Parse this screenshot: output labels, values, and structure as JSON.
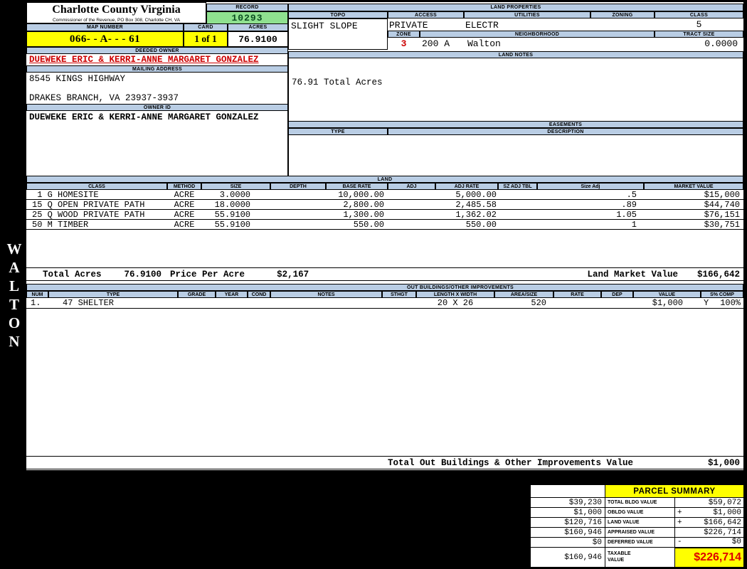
{
  "colors": {
    "header_blue": "#b9cde4",
    "highlight_yellow": "#ffff00",
    "record_green": "#8fe18f",
    "alert_red": "#cc0000"
  },
  "sidebar": {
    "watermark": "WALTON"
  },
  "header": {
    "county": "Charlotte County Virginia",
    "commissioner": "Commissioner of the Revenue, PO Box 308, Charlotte CH, VA",
    "record_label": "RECORD",
    "record_value": "10293",
    "map_number_label": "MAP NUMBER",
    "map_number": "066- - A- - - 61",
    "card_label": "CARD",
    "card_value": "1 of 1",
    "acres_label": "ACRES",
    "acres_value": "76.9100"
  },
  "land_properties": {
    "title": "LAND PROPERTIES",
    "topo_label": "TOPO",
    "topo": "SLIGHT SLOPE",
    "access_label": "ACCESS",
    "access": "PRIVATE",
    "utilities_label": "UTILITIES",
    "utilities": "ELECTR",
    "zoning_label": "ZONING",
    "class_label": "CLASS",
    "class": "5",
    "zone_label": "ZONE",
    "zone": "3",
    "zone_area": "200 A",
    "neighborhood_label": "NEIGHBORHOOD",
    "neighborhood": "Walton",
    "tract_size_label": "TRACT SIZE",
    "tract_size": "0.0000"
  },
  "owner": {
    "deeded_owner_label": "DEEDED OWNER",
    "deeded_owner": "DUEWEKE ERIC & KERRI-ANNE MARGARET GONZALEZ",
    "mailing_address_label": "MAILING ADDRESS",
    "address_line1": "8545 KINGS HIGHWAY",
    "address_line2": "DRAKES BRANCH, VA 23937-3937",
    "owner_id_label": "OWNER ID",
    "owner_id": "DUEWEKE ERIC & KERRI-ANNE MARGARET GONZALEZ"
  },
  "land_notes": {
    "title": "LAND NOTES",
    "note": "76.91 Total Acres"
  },
  "easements": {
    "title": "EASEMENTS",
    "type_label": "TYPE",
    "description_label": "DESCRIPTION"
  },
  "land": {
    "title": "LAND",
    "columns": [
      "CLASS",
      "METHOD",
      "SIZE",
      "DEPTH",
      "BASE RATE",
      "ADJ",
      "ADJ RATE",
      "SZ ADJ TBL",
      "Size Adj",
      "MARKET VALUE"
    ],
    "rows": [
      {
        "class": " 1 G HOMESITE",
        "method": "ACRE",
        "size": "3.0000",
        "base_rate": "10,000.00",
        "adj_rate": "5,000.00",
        "size_adj": ".5",
        "market_value": "$15,000"
      },
      {
        "class": "15 Q OPEN PRIVATE PATH",
        "method": "ACRE",
        "size": "18.0000",
        "base_rate": "2,800.00",
        "adj_rate": "2,485.58",
        "size_adj": ".89",
        "market_value": "$44,740"
      },
      {
        "class": "25 Q WOOD PRIVATE PATH",
        "method": "ACRE",
        "size": "55.9100",
        "base_rate": "1,300.00",
        "adj_rate": "1,362.02",
        "size_adj": "1.05",
        "market_value": "$76,151"
      },
      {
        "class": "50 M TIMBER",
        "method": "ACRE",
        "size": "55.9100",
        "base_rate": "550.00",
        "adj_rate": "550.00",
        "size_adj": "1",
        "market_value": "$30,751"
      }
    ],
    "total_acres_label": "Total Acres",
    "total_acres": "76.9100",
    "price_per_acre_label": "Price Per Acre",
    "price_per_acre": "$2,167",
    "market_value_label": "Land Market Value",
    "market_value": "$166,642"
  },
  "out_buildings": {
    "title": "OUT BUILDINGS/OTHER IMPROVEMENTS",
    "columns": [
      "NUM",
      "TYPE",
      "GRADE",
      "YEAR",
      "COND",
      "NOTES",
      "STHGT",
      "LENGTH X WIDTH",
      "AREA/SIZE",
      "RATE",
      "DEP",
      "VALUE",
      "S% COMP"
    ],
    "rows": [
      {
        "num": "1.",
        "type": "47 SHELTER",
        "length_width": "20 X 26",
        "area_size": "520",
        "value": "$1,000",
        "complete_flag": "Y",
        "percent_complete": "100%"
      }
    ],
    "total_label": "Total Out Buildings & Other Improvements Value",
    "total_value": "$1,000"
  },
  "parcel_summary": {
    "title": "PARCEL SUMMARY",
    "rows": [
      {
        "prior": "$39,230",
        "label": "TOTAL BLDG VALUE",
        "sign": "",
        "value": "$59,072"
      },
      {
        "prior": "$1,000",
        "label": "OBLDG VALUE",
        "sign": "+",
        "value": "$1,000"
      },
      {
        "prior": "$120,716",
        "label": "LAND VALUE",
        "sign": "+",
        "value": "$166,642"
      },
      {
        "prior": "$160,946",
        "label": "APPRAISED VALUE",
        "sign": "",
        "value": "$226,714"
      },
      {
        "prior": "$0",
        "label": "DEFERRED VALUE",
        "sign": "-",
        "value": "$0"
      },
      {
        "prior": "$160,946",
        "label": "TAXABLE VALUE",
        "sign": "",
        "value": "$226,714"
      }
    ]
  }
}
